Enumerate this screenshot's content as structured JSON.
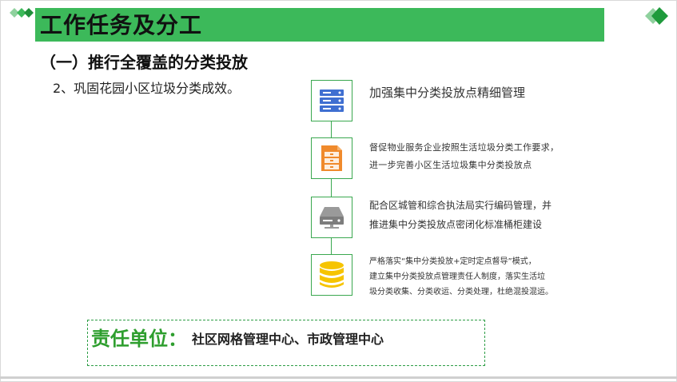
{
  "header": {
    "title": "工作任务及分工"
  },
  "section": {
    "heading": "（一）推行全覆盖的分类投放",
    "subheading": "2、巩固花园小区垃圾分类成效。"
  },
  "timeline": {
    "items": [
      {
        "icon": "server-stack-icon",
        "lines": [
          "加强集中分类投放点精细管理"
        ]
      },
      {
        "icon": "file-cabinet-icon",
        "lines": [
          "督促物业服务企业按照生活垃圾分类工作要求，",
          "进一步完善小区生活垃圾集中分类投放点"
        ]
      },
      {
        "icon": "storage-drive-icon",
        "lines": [
          "配合区城管和综合执法局实行编码管理，并",
          "推进集中分类投放点密闭化标准桶柜建设"
        ]
      },
      {
        "icon": "database-icon",
        "lines": [
          "严格落实“集中分类投放+定时定点督导”模式，",
          "建立集中分类投放点管理责任人制度，落实生活垃",
          "圾分类收集、分类收运、分类处理，杜绝混投混运。"
        ]
      }
    ]
  },
  "responsibility": {
    "label": "责任单位：",
    "value": "社区网格管理中心、市政管理中心"
  },
  "colors": {
    "title_bar": "#3cb95a",
    "accent_green": "#2e9e2e",
    "icon_blue": "#3f6fd1",
    "icon_orange": "#f08a2c",
    "icon_gray": "#9a9a9a",
    "icon_yellow": "#f6c400"
  }
}
